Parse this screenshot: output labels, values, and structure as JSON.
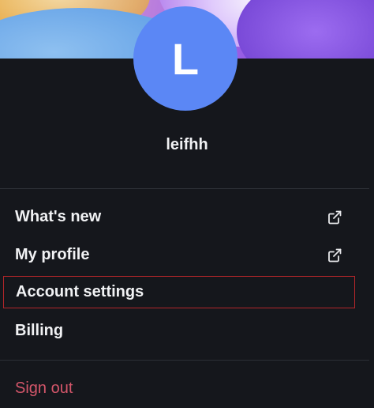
{
  "profile": {
    "avatar_initial": "L",
    "username": "leifhh",
    "avatar_color": "#5b87f5"
  },
  "menu": {
    "items": [
      {
        "label": "What's new",
        "icon": "external-link-icon"
      },
      {
        "label": "My profile",
        "icon": "external-link-icon"
      },
      {
        "label": "Account settings",
        "highlighted": true
      },
      {
        "label": "Billing"
      }
    ],
    "sign_out_label": "Sign out"
  },
  "colors": {
    "background": "#15171c",
    "highlight_border": "#b3262a",
    "sign_out": "#d4566a"
  }
}
